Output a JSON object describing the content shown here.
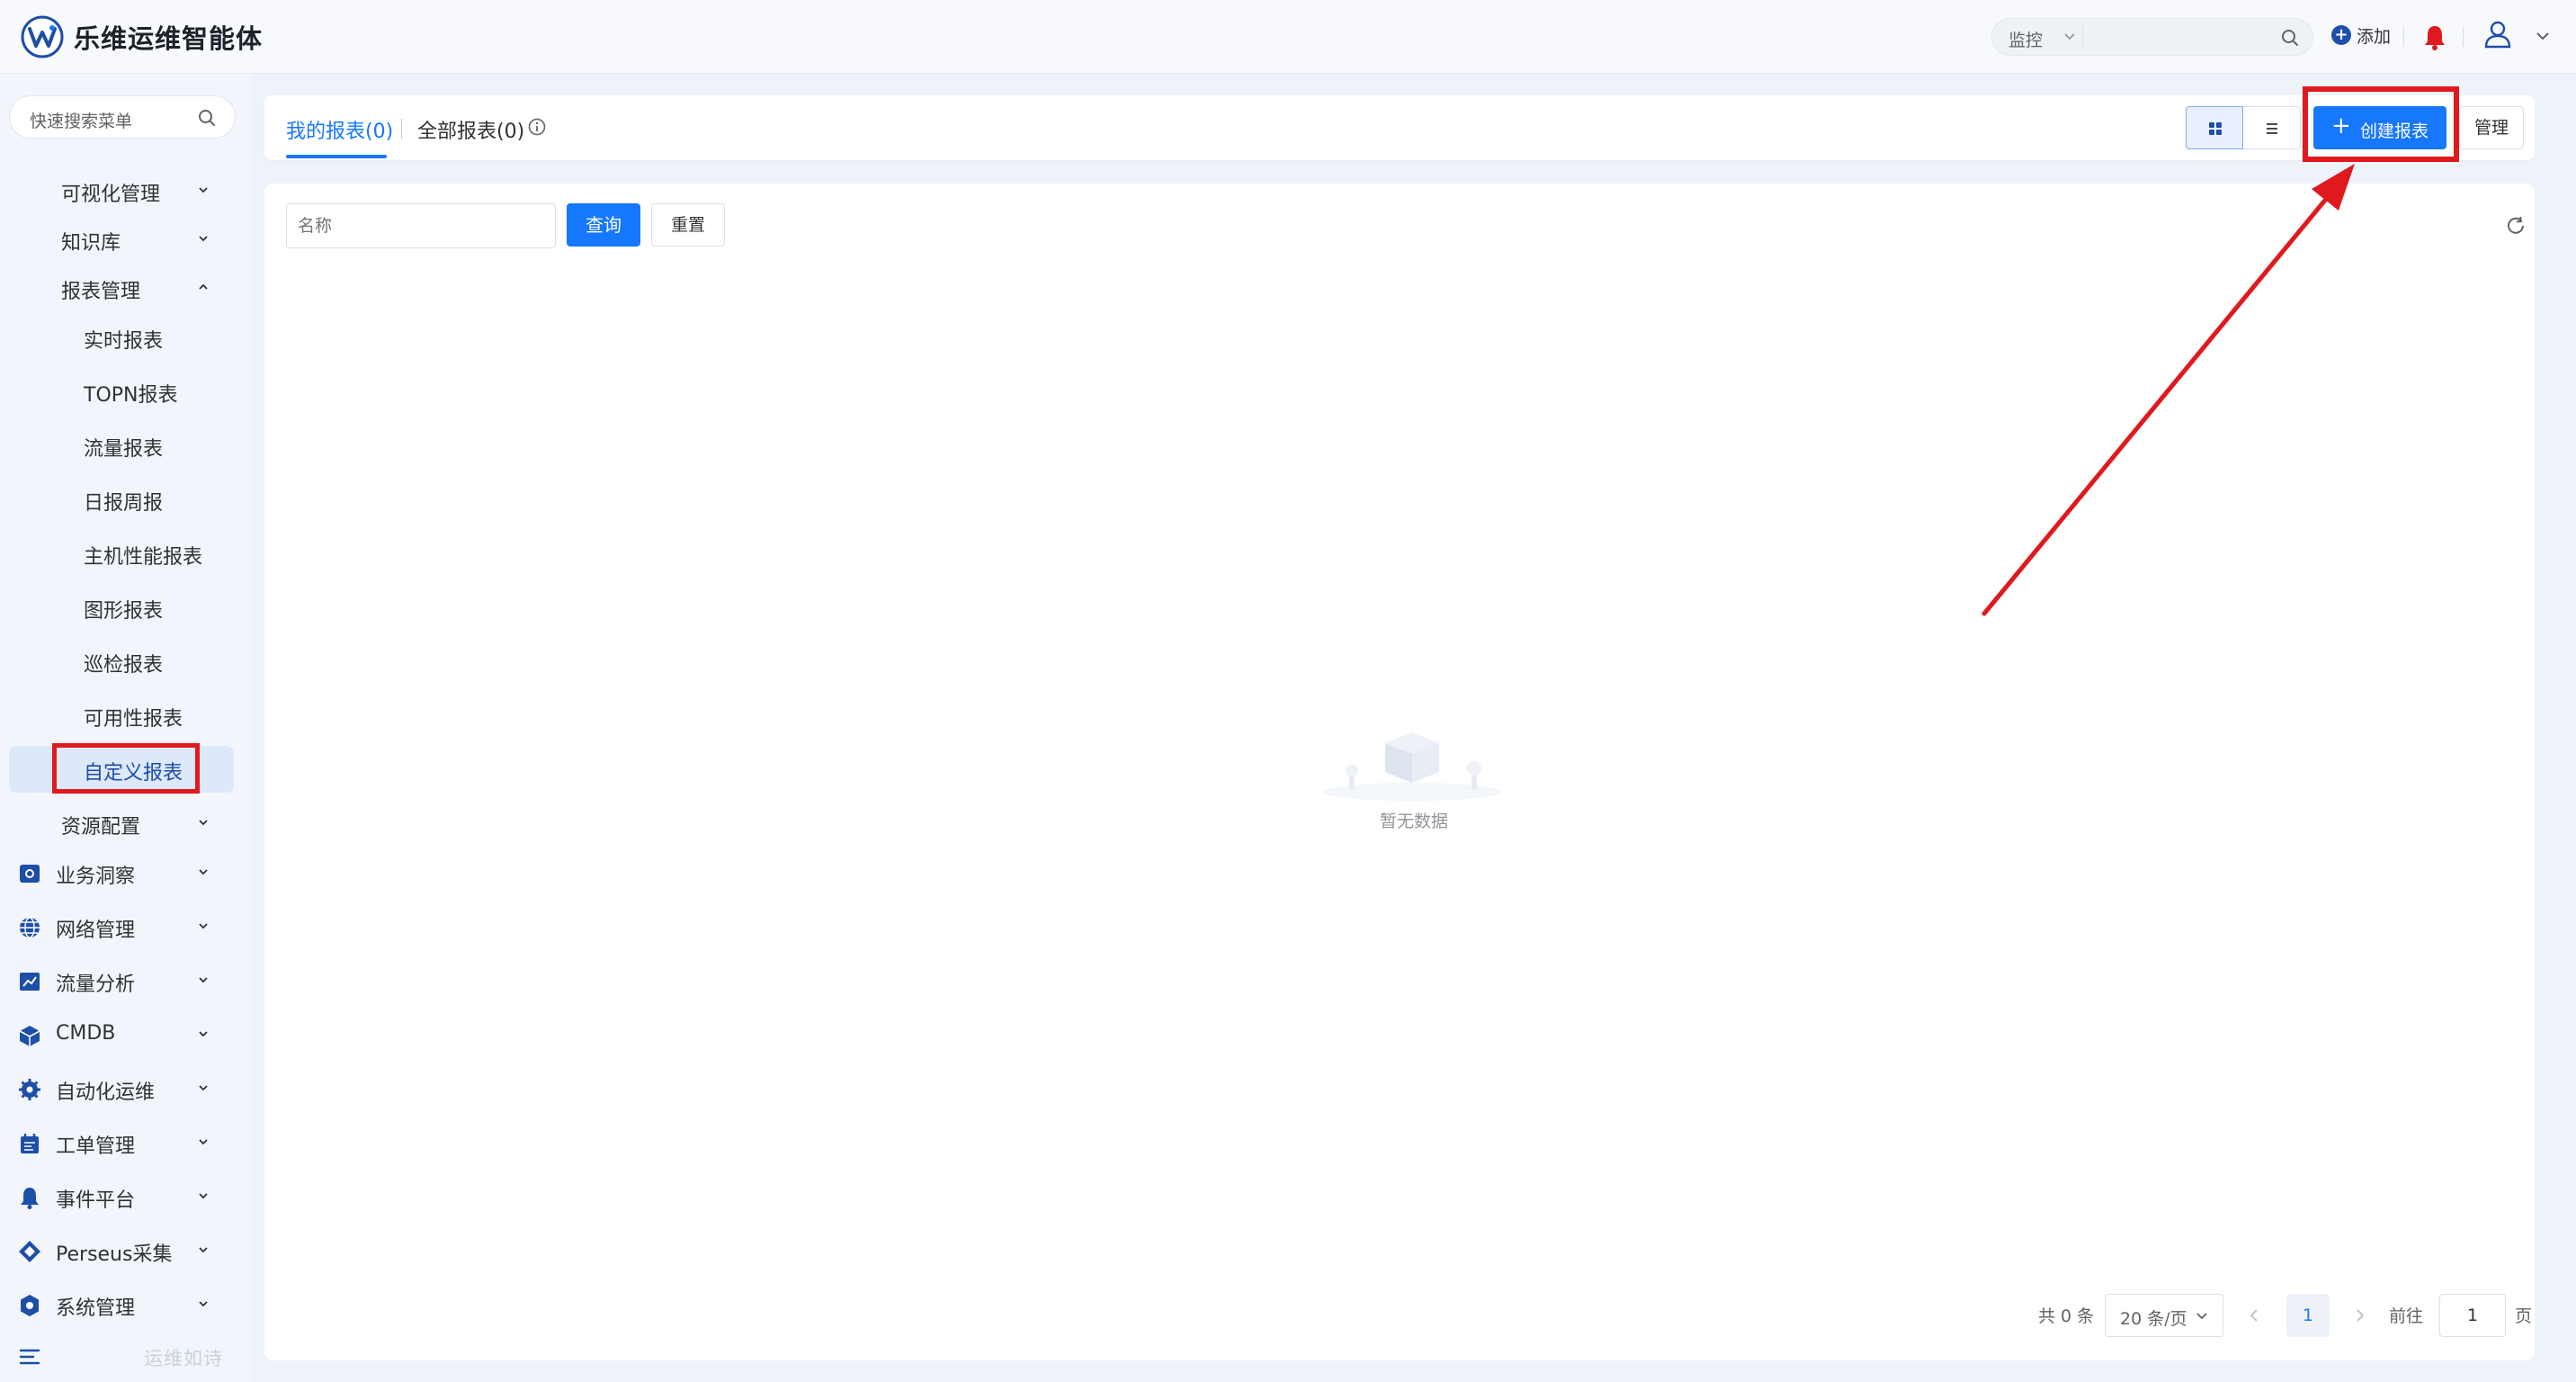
{
  "header": {
    "app_title": "乐维运维智能体",
    "search_scope": "监控",
    "add_label": "添加",
    "icons": [
      "logo-icon",
      "search-icon",
      "plus-circle-icon",
      "bell-icon",
      "user-icon",
      "chevron-down-icon"
    ],
    "bell_color": "#e0191e"
  },
  "sidebar": {
    "search_placeholder": "快速搜索菜单",
    "items": [
      {
        "label": "可视化管理",
        "level": "sub",
        "expanded": false
      },
      {
        "label": "知识库",
        "level": "sub",
        "expanded": false
      },
      {
        "label": "报表管理",
        "level": "sub",
        "expanded": true
      },
      {
        "label": "实时报表",
        "level": "leaf"
      },
      {
        "label": "TOPN报表",
        "level": "leaf"
      },
      {
        "label": "流量报表",
        "level": "leaf"
      },
      {
        "label": "日报周报",
        "level": "leaf"
      },
      {
        "label": "主机性能报表",
        "level": "leaf"
      },
      {
        "label": "图形报表",
        "level": "leaf"
      },
      {
        "label": "巡检报表",
        "level": "leaf"
      },
      {
        "label": "可用性报表",
        "level": "leaf"
      },
      {
        "label": "自定义报表",
        "level": "leaf",
        "active": true
      },
      {
        "label": "资源配置",
        "level": "sub",
        "expanded": false
      },
      {
        "label": "业务洞察",
        "level": "top",
        "icon": "business-insight-icon"
      },
      {
        "label": "网络管理",
        "level": "top",
        "icon": "globe-icon"
      },
      {
        "label": "流量分析",
        "level": "top",
        "icon": "traffic-chart-icon"
      },
      {
        "label": "CMDB",
        "level": "top",
        "icon": "cube-icon"
      },
      {
        "label": "自动化运维",
        "level": "top",
        "icon": "gear-icon"
      },
      {
        "label": "工单管理",
        "level": "top",
        "icon": "calendar-icon"
      },
      {
        "label": "事件平台",
        "level": "top",
        "icon": "bell-icon"
      },
      {
        "label": "Perseus采集",
        "level": "top",
        "icon": "diamond-icon"
      },
      {
        "label": "系统管理",
        "level": "top",
        "icon": "settings-icon"
      }
    ],
    "footer_motto": "运维如诗"
  },
  "tabs": {
    "my_reports": "我的报表(0)",
    "all_reports": "全部报表(0)"
  },
  "toolbar": {
    "create_label": "创建报表",
    "manage_label": "管理",
    "view_mode": "grid"
  },
  "filter": {
    "name_placeholder": "名称",
    "query_label": "查询",
    "reset_label": "重置"
  },
  "empty": {
    "text": "暂无数据"
  },
  "pagination": {
    "total": "共 0 条",
    "page_size": "20 条/页",
    "current_page": "1",
    "goto_label": "前往",
    "goto_value": "1",
    "page_suffix": "页"
  },
  "annotations": {
    "highlight_color": "#e0191e"
  }
}
